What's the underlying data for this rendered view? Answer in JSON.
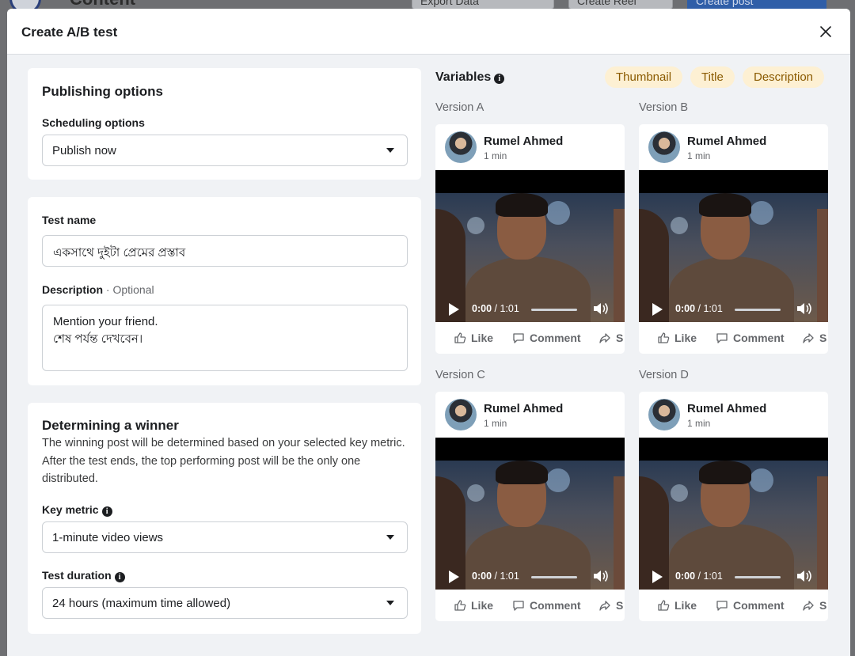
{
  "background": {
    "page_title": "Content",
    "export_label": "Export Data",
    "reel_label": "Create Reel",
    "post_label": "Create post"
  },
  "modal": {
    "title": "Create A/B test"
  },
  "publishing": {
    "heading": "Publishing options",
    "scheduling_label": "Scheduling options",
    "scheduling_value": "Publish now"
  },
  "details": {
    "test_name_label": "Test name",
    "test_name_value": "একসাথে দুইটা প্রেমের প্রস্তাব",
    "description_label": "Description",
    "description_optional": "· Optional",
    "description_line1": "Mention your friend.",
    "description_line2": "শেষ পর্যন্ত দেখবেন।"
  },
  "winner": {
    "heading": "Determining a winner",
    "text": "The winning post will be determined based on your selected key metric. After the test ends, the top performing post will be the only one distributed.",
    "key_metric_label": "Key metric",
    "key_metric_value": "1-minute video views",
    "duration_label": "Test duration",
    "duration_value": "24 hours (maximum time allowed)"
  },
  "variables": {
    "label": "Variables",
    "chips": [
      "Thumbnail",
      "Title",
      "Description"
    ]
  },
  "versions": [
    {
      "label": "Version A",
      "author": "Rumel Ahmed",
      "time": "1 min",
      "video_time": "0:00",
      "video_duration": "/ 1:01",
      "like": "Like",
      "comment": "Comment",
      "share": "S"
    },
    {
      "label": "Version B",
      "author": "Rumel Ahmed",
      "time": "1 min",
      "video_time": "0:00",
      "video_duration": "/ 1:01",
      "like": "Like",
      "comment": "Comment",
      "share": "S"
    },
    {
      "label": "Version C",
      "author": "Rumel Ahmed",
      "time": "1 min",
      "video_time": "0:00",
      "video_duration": "/ 1:01",
      "like": "Like",
      "comment": "Comment",
      "share": "S"
    },
    {
      "label": "Version D",
      "author": "Rumel Ahmed",
      "time": "1 min",
      "video_time": "0:00",
      "video_duration": "/ 1:01",
      "like": "Like",
      "comment": "Comment",
      "share": "S"
    }
  ]
}
